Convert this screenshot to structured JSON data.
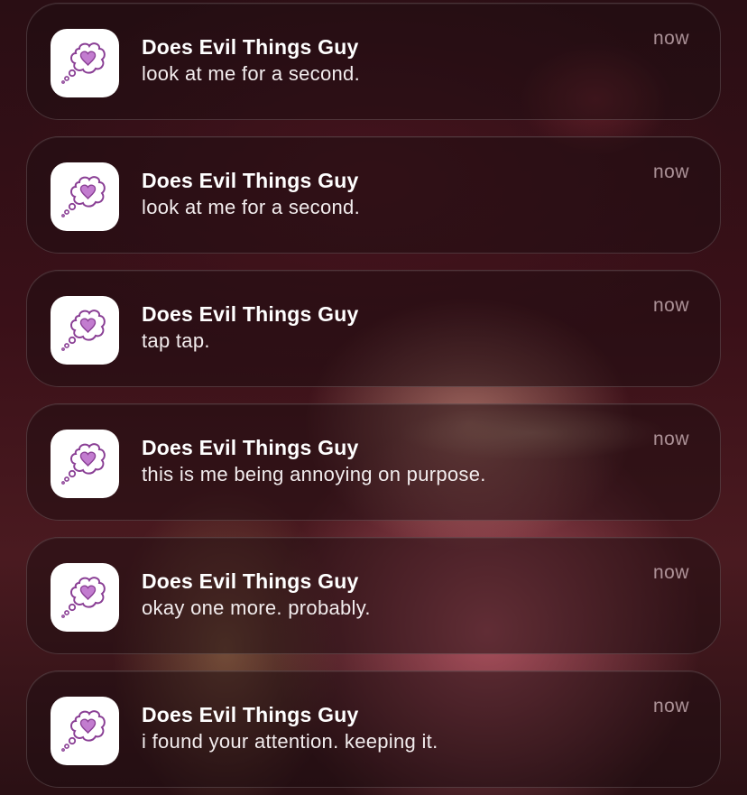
{
  "notifications": [
    {
      "app_name": "Does Evil Things Guy",
      "message": "look at me for a second.",
      "time": "now",
      "icon": "thought-bubble-heart-icon"
    },
    {
      "app_name": "Does Evil Things Guy",
      "message": "look at me for a second.",
      "time": "now",
      "icon": "thought-bubble-heart-icon"
    },
    {
      "app_name": "Does Evil Things Guy",
      "message": "tap tap.",
      "time": "now",
      "icon": "thought-bubble-heart-icon"
    },
    {
      "app_name": "Does Evil Things Guy",
      "message": "this is me being annoying on purpose.",
      "time": "now",
      "icon": "thought-bubble-heart-icon"
    },
    {
      "app_name": "Does Evil Things Guy",
      "message": "okay one more. probably.",
      "time": "now",
      "icon": "thought-bubble-heart-icon"
    },
    {
      "app_name": "Does Evil Things Guy",
      "message": "i found your attention. keeping it.",
      "time": "now",
      "icon": "thought-bubble-heart-icon"
    }
  ],
  "colors": {
    "icon_stroke": "#8a3f95",
    "heart_fill": "#c27ccf"
  }
}
